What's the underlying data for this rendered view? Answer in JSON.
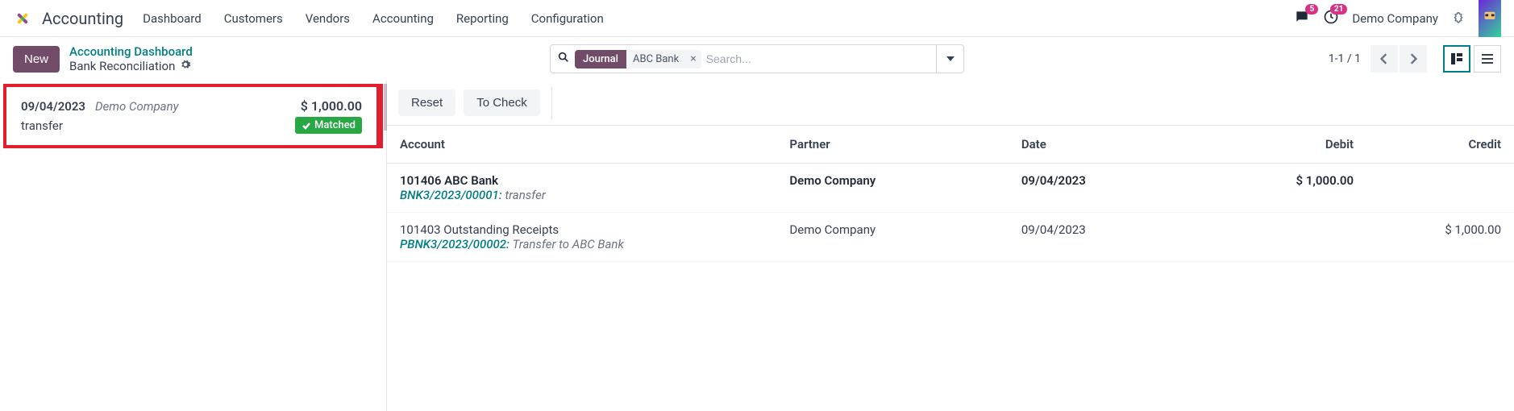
{
  "topnav": {
    "app_name": "Accounting",
    "menu": [
      "Dashboard",
      "Customers",
      "Vendors",
      "Accounting",
      "Reporting",
      "Configuration"
    ],
    "msg_badge": "5",
    "activity_badge": "21",
    "company": "Demo Company"
  },
  "actionbar": {
    "new_label": "New",
    "breadcrumb_link": "Accounting Dashboard",
    "breadcrumb_current": "Bank Reconciliation",
    "search_facet_label": "Journal",
    "search_facet_value": "ABC Bank",
    "search_placeholder": "Search...",
    "pager": "1-1 / 1"
  },
  "statement": {
    "date": "09/04/2023",
    "partner": "Demo Company",
    "amount": "$ 1,000.00",
    "memo": "transfer",
    "badge": "Matched"
  },
  "right": {
    "reset": "Reset",
    "to_check": "To Check",
    "headers": {
      "account": "Account",
      "partner": "Partner",
      "date": "Date",
      "debit": "Debit",
      "credit": "Credit"
    },
    "rows": [
      {
        "account": "101406 ABC Bank",
        "move": "BNK3/2023/00001:",
        "memo": "transfer",
        "partner": "Demo Company",
        "date": "09/04/2023",
        "debit": "$ 1,000.00",
        "credit": ""
      },
      {
        "account": "101403 Outstanding Receipts",
        "move": "PBNK3/2023/00002:",
        "memo": "Transfer to ABC Bank",
        "partner": "Demo Company",
        "date": "09/04/2023",
        "debit": "",
        "credit": "$ 1,000.00"
      }
    ]
  }
}
